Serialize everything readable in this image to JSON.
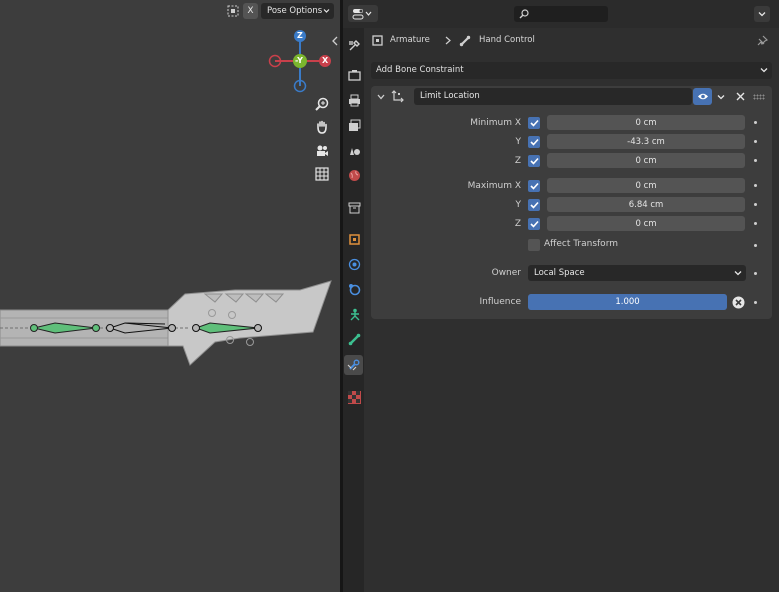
{
  "viewport": {
    "x_button": "X",
    "pose_options_label": "Pose Options",
    "gizmo": {
      "z": "Z",
      "neg_y": "-Y",
      "x": "X"
    }
  },
  "properties": {
    "search": {
      "placeholder": ""
    },
    "breadcrumb": {
      "armature": "Armature",
      "bone": "Hand Control"
    },
    "add_constraint_label": "Add Bone Constraint",
    "constraint": {
      "name": "Limit Location",
      "minimum": {
        "label_x": "Minimum X",
        "label_y": "Y",
        "label_z": "Z",
        "x_value": "0 cm",
        "y_value": "-43.3 cm",
        "z_value": "0 cm"
      },
      "maximum": {
        "label_x": "Maximum X",
        "label_y": "Y",
        "label_z": "Z",
        "x_value": "0 cm",
        "y_value": "6.84 cm",
        "z_value": "0 cm"
      },
      "affect_transform_label": "Affect Transform",
      "owner_label": "Owner",
      "owner_value": "Local Space",
      "influence_label": "Influence",
      "influence_value": "1.000",
      "influence_fraction": 1.0
    }
  },
  "colors": {
    "accent": "#4772b3",
    "gizmo_x": "#c9404b",
    "gizmo_y": "#7bb52e",
    "gizmo_z": "#3a7bc8",
    "bone_green": "#5fbf7a"
  }
}
